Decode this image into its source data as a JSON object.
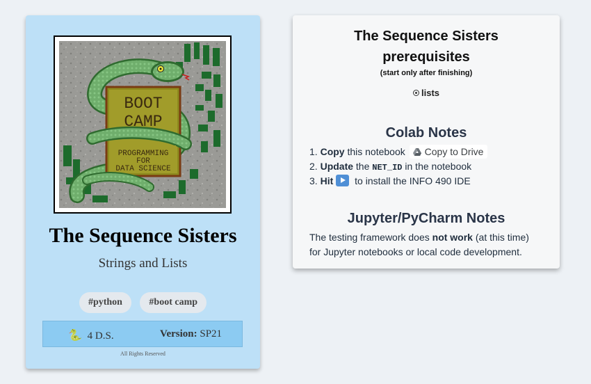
{
  "book": {
    "cover_text": {
      "line1": "BOOT",
      "line2": "CAMP",
      "line3": "PROGRAMMING",
      "line4": "FOR",
      "line5": "DATA SCIENCE"
    },
    "title": "The Sequence Sisters",
    "subtitle": "Strings and Lists",
    "tags": [
      "#python",
      "#boot camp"
    ],
    "footer": {
      "snake_icon": "snake-icon",
      "author": "4 D.S.",
      "version_label": "Version:",
      "version_value": "SP21"
    },
    "rights": "All Rights Reserved"
  },
  "info": {
    "title": "The Sequence Sisters",
    "prereq_heading": "prerequisites",
    "prereq_note": "(start only after finishing)",
    "prereq_items": [
      "lists"
    ],
    "colab": {
      "heading": "Colab Notes",
      "step1_num": "1.",
      "step1_bold": "Copy",
      "step1_text": "this notebook",
      "copy_button": "Copy to Drive",
      "step2_num": "2.",
      "step2_bold": "Update",
      "step2_text_a": "the",
      "step2_code": "NET_ID",
      "step2_text_b": "in the notebook",
      "step3_num": "3.",
      "step3_bold": "Hit",
      "step3_text": "to install the INFO 490 IDE"
    },
    "jupyter": {
      "heading": "Jupyter/PyCharm Notes",
      "text_a": "The testing framework does",
      "text_bold": "not work",
      "text_b": "(at this time)",
      "text_c": "for Jupyter notebooks or local code development."
    }
  },
  "colors": {
    "card_bg": "#bde0f7",
    "footer_bg": "#8ccbf2",
    "page_bg": "#edf1f5",
    "panel_bg": "#f6f7f8",
    "play_button": "#4f8fd6"
  }
}
